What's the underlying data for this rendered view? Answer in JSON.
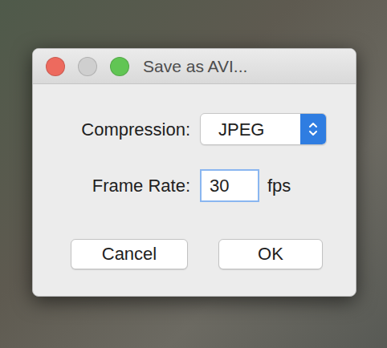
{
  "window": {
    "title": "Save as AVI...",
    "controls": [
      {
        "name": "close",
        "color": "#ed6a5e"
      },
      {
        "name": "minimize",
        "color": "#cfcfcf"
      },
      {
        "name": "zoom",
        "color": "#61c554"
      }
    ]
  },
  "compression": {
    "label": "Compression:",
    "value": "JPEG"
  },
  "frame_rate": {
    "label": "Frame Rate:",
    "value": "30",
    "unit": "fps",
    "focused": true
  },
  "buttons": [
    {
      "label": "Cancel"
    },
    {
      "label": "OK"
    }
  ]
}
